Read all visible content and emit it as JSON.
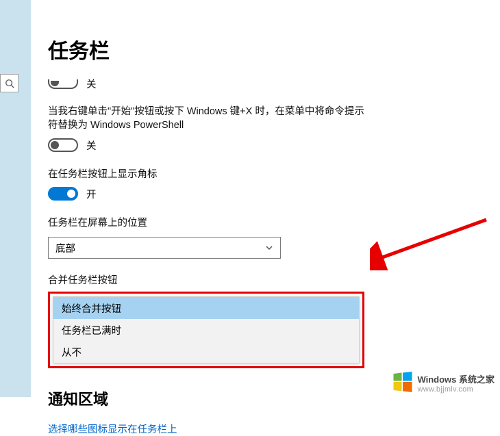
{
  "page": {
    "title": "任务栏"
  },
  "toggle_partial": {
    "state_label": "关"
  },
  "setting_powershell": {
    "label": "当我右键单击\"开始\"按钮或按下 Windows 键+X 时，在菜单中将命令提示符替换为 Windows PowerShell",
    "state_label": "关"
  },
  "setting_badges": {
    "label": "在任务栏按钮上显示角标",
    "state_label": "开"
  },
  "setting_location": {
    "label": "任务栏在屏幕上的位置",
    "selected": "底部"
  },
  "setting_combine": {
    "label": "合并任务栏按钮",
    "options": {
      "0": {
        "label": "始终合并按钮",
        "selected": true
      },
      "1": {
        "label": "任务栏已满时",
        "selected": false
      },
      "2": {
        "label": "从不",
        "selected": false
      }
    }
  },
  "section_notification": {
    "heading": "通知区域",
    "link": "选择哪些图标显示在任务栏上"
  },
  "watermark": {
    "title": "Windows 系统之家",
    "url": "www.bjjmlv.com"
  }
}
